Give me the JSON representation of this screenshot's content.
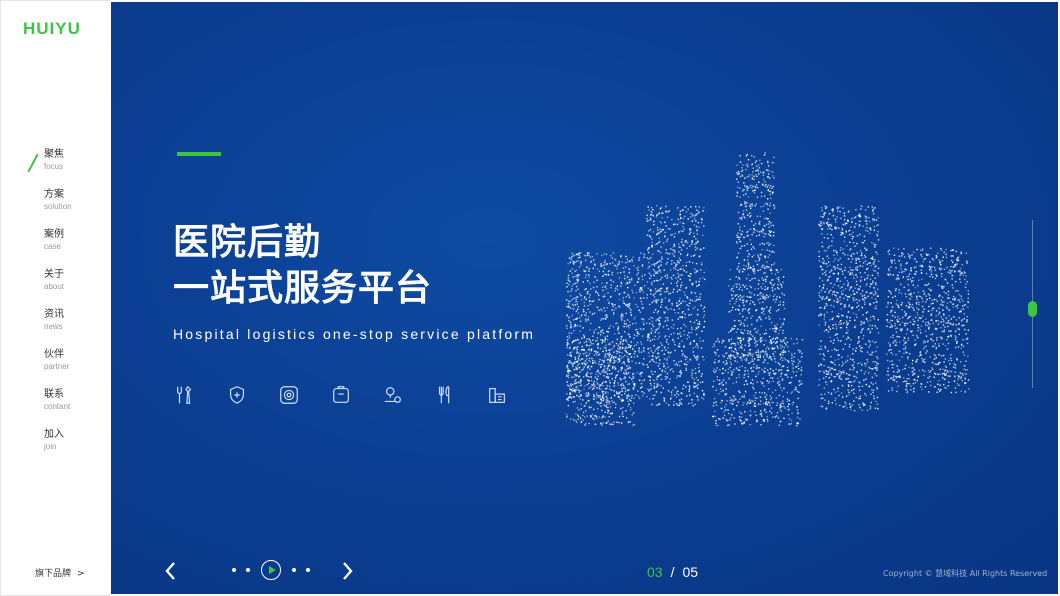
{
  "brand": {
    "logo_text": "HUIYU",
    "color": "#3cc443"
  },
  "nav": {
    "items": [
      {
        "zh": "聚焦",
        "en": "focus",
        "active": true
      },
      {
        "zh": "方案",
        "en": "solution"
      },
      {
        "zh": "案例",
        "en": "case"
      },
      {
        "zh": "关于",
        "en": "about"
      },
      {
        "zh": "资讯",
        "en": "news"
      },
      {
        "zh": "伙伴",
        "en": "partner"
      },
      {
        "zh": "联系",
        "en": "contant"
      },
      {
        "zh": "加入",
        "en": "join"
      }
    ],
    "brand_link": "旗下品牌",
    "brand_link_arrow": ">"
  },
  "hero": {
    "title_line1": "医院后勤",
    "title_line2": "一站式服务平台",
    "subtitle": "Hospital logistics one-stop service platform",
    "background": "#0b3f93",
    "service_icons": [
      "tools-icon",
      "shield-medicine-icon",
      "target-icon",
      "tag-icon",
      "location-icon",
      "fork-spoon-icon",
      "building-icon"
    ]
  },
  "pagination": {
    "current": "03",
    "separator": "/",
    "total": "05"
  },
  "scroll": {
    "position": 0.5
  },
  "footer": {
    "copyright": "Copyright © 慧域科技 All Rights Reserved"
  }
}
